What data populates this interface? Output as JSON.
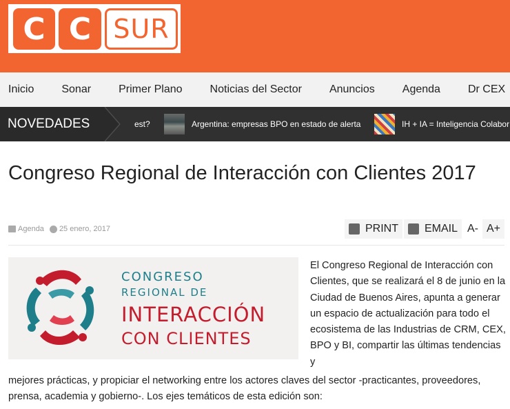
{
  "logo": {
    "letter1": "C",
    "letter2": "C",
    "word": "SUR"
  },
  "nav": {
    "items": [
      "Inicio",
      "Sonar",
      "Primer Plano",
      "Noticias del Sector",
      "Anuncios",
      "Agenda",
      "Dr CEX"
    ]
  },
  "ticker": {
    "label": "NOVEDADES",
    "items": [
      {
        "text": "est?"
      },
      {
        "text": "Argentina: empresas BPO en estado de alerta"
      },
      {
        "text": "IH + IA = Inteligencia Colabor"
      }
    ]
  },
  "article": {
    "title": "Congreso Regional de Interacción con Clientes 2017",
    "category": "Agenda",
    "date": "25 enero, 2017",
    "tools": {
      "print": "PRINT",
      "email": "EMAIL",
      "font_down": "A-",
      "font_up": "A+"
    },
    "figure": {
      "line1": "CONGRESO",
      "line2": "REGIONAL DE",
      "line3": "INTERACCIÓN",
      "line4": "CON CLIENTES"
    },
    "body_part1": "El Congreso Regional de Interacción con Clientes, que se realizará el 8 de junio en la Ciudad de Buenos Aires, apunta a generar un espacio de actualización para todo el ecosistema de las Industrias de CRM, CEX, BPO y BI, compartir las últimas tendencias y",
    "body_part2": "mejores prácticas, y propiciar el networking entre los actores claves del sector -practicantes, proveedores, prensa, academia y gobierno-. Los ejes temáticos de esta edición son:"
  },
  "colors": {
    "brand_orange": "#f26530",
    "ticker_bg": "#303030",
    "logo_red": "#c31d2d",
    "logo_teal": "#1e7f8a"
  }
}
